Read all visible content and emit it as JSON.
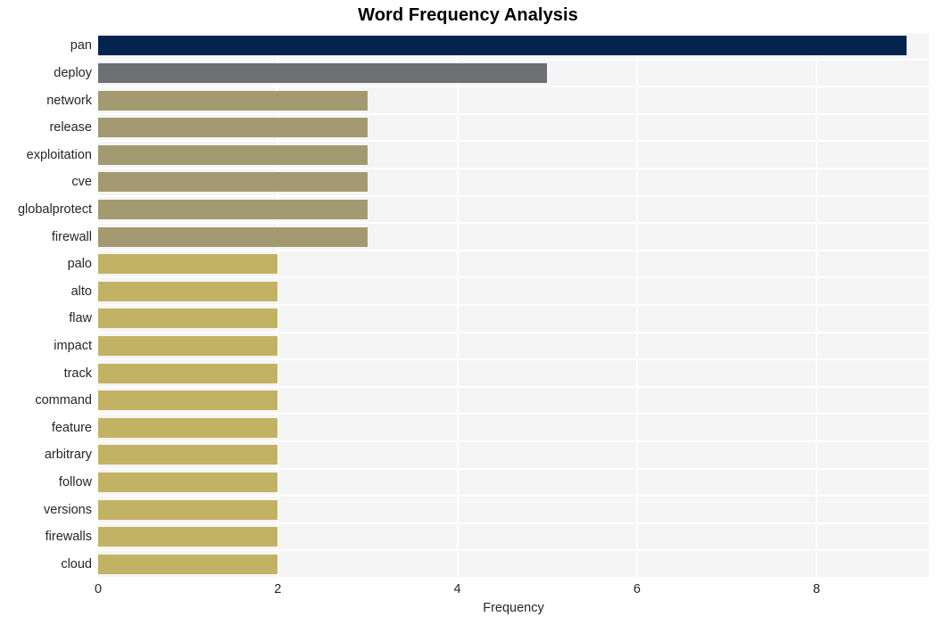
{
  "chart_data": {
    "type": "bar",
    "orientation": "horizontal",
    "title": "Word Frequency Analysis",
    "xlabel": "Frequency",
    "ylabel": "",
    "xlim": [
      0,
      9.25
    ],
    "ylim": [
      0,
      20
    ],
    "grid": true,
    "legend": null,
    "xticks": [
      "0",
      "2",
      "4",
      "6",
      "8"
    ],
    "xtick_values": [
      0,
      2,
      4,
      6,
      8
    ],
    "categories": [
      "pan",
      "deploy",
      "network",
      "release",
      "exploitation",
      "cve",
      "globalprotect",
      "firewall",
      "palo",
      "alto",
      "flaw",
      "impact",
      "track",
      "command",
      "feature",
      "arbitrary",
      "follow",
      "versions",
      "firewalls",
      "cloud"
    ],
    "values": [
      9,
      5,
      3,
      3,
      3,
      3,
      3,
      3,
      2,
      2,
      2,
      2,
      2,
      2,
      2,
      2,
      2,
      2,
      2,
      2
    ],
    "bar_colors": [
      "#04244f",
      "#6e6f73",
      "#a39a72",
      "#a39a72",
      "#a39a72",
      "#a39a72",
      "#a39a72",
      "#a39a72",
      "#c2b263",
      "#c2b263",
      "#c2b263",
      "#c2b263",
      "#c2b263",
      "#c2b263",
      "#c2b263",
      "#c2b263",
      "#c2b263",
      "#c2b263",
      "#c2b263",
      "#c2b263"
    ],
    "plot_background": "#f5f5f5",
    "grid_color": "#ffffff",
    "text_color": "#262626",
    "page_background": "#ffffff"
  }
}
